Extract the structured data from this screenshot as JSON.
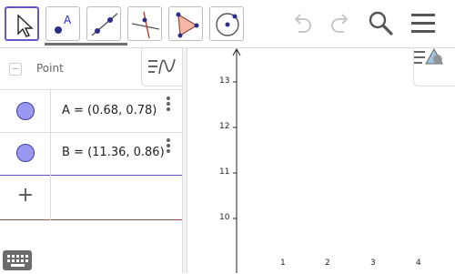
{
  "algebra": {
    "group_label": "Point",
    "items": [
      {
        "expression": "A = (0.68, 0.78)"
      },
      {
        "expression": "B = (11.36, 0.86)"
      }
    ],
    "input_placeholder": ""
  },
  "graphics": {
    "y_ticks": [
      "13",
      "12",
      "11",
      "10"
    ],
    "x_ticks": [
      "1",
      "2",
      "3",
      "4"
    ]
  },
  "colors": {
    "accent": "#6557d2",
    "point_fill": "#9b98f2",
    "polygon_fill": "#f5b7a8"
  }
}
